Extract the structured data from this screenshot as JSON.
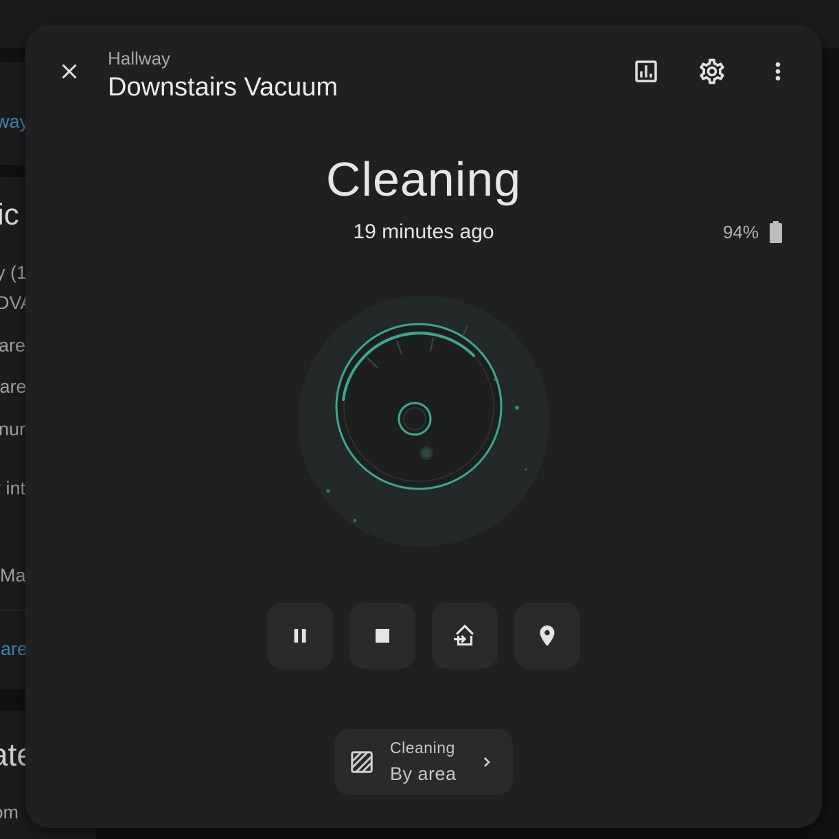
{
  "background": {
    "fragments": [
      "way",
      "ic",
      "y (1",
      "DVA",
      "are",
      "vare",
      "nur",
      "r int",
      "Ma",
      "hare",
      "ate",
      "tom"
    ]
  },
  "dialog": {
    "breadcrumb": "Hallway",
    "title": "Downstairs Vacuum",
    "header_icons": [
      "close-icon",
      "chart-icon",
      "gear-icon",
      "dots-vertical-icon"
    ]
  },
  "status": {
    "state": "Cleaning",
    "last_changed": "19 minutes ago",
    "battery": "94%",
    "battery_icon": "battery-icon"
  },
  "controls": {
    "buttons": [
      {
        "name": "pause",
        "icon": "pause-icon"
      },
      {
        "name": "stop",
        "icon": "stop-icon"
      },
      {
        "name": "return-home",
        "icon": "home-import-icon"
      },
      {
        "name": "locate",
        "icon": "map-marker-icon"
      }
    ]
  },
  "mode": {
    "label": "Cleaning",
    "value": "By area",
    "icon": "texture-box-icon"
  },
  "colors": {
    "accent": "#3aa893",
    "surface": "#202020",
    "button": "#2a2a2a"
  }
}
